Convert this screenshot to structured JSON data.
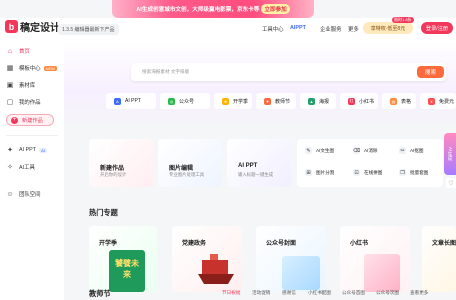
{
  "banner": {
    "text": "AI生成创意城市文创，大师级赢电影票，京东卡等",
    "cta": "立即参加"
  },
  "header": {
    "logo": "稿定设计",
    "slogan": "1.3.5 编辑器最新下产品",
    "nav": [
      "工具中心",
      "AIPPT",
      "企业服务",
      "更多"
    ],
    "vip": "享特权·低至8元",
    "vip_tag": "限时1.8折",
    "register": "登录/注册"
  },
  "sidebar": {
    "items": [
      {
        "label": "首页",
        "icon": "home-icon"
      },
      {
        "label": "模板中心",
        "icon": "template-icon",
        "tag": "NEW"
      },
      {
        "label": "素材库",
        "icon": "material-icon"
      },
      {
        "label": "我的作品",
        "icon": "folder-icon"
      }
    ],
    "new_work": "新建作品",
    "ai": [
      {
        "label": "AI PPT",
        "tag": "AI"
      },
      {
        "label": "AI工具"
      }
    ],
    "team": "团队空间"
  },
  "search": {
    "placeholder": "搜索海报素材 文字排版",
    "button": "搜索"
  },
  "quick": [
    "AI PPT",
    "公众号",
    "开学季",
    "教师节",
    "海报",
    "小红书",
    "表格",
    "免费元"
  ],
  "cards": [
    {
      "title": "新建作品",
      "sub": "开启你的设计"
    },
    {
      "title": "图片编辑",
      "sub": "专业图片处理工具"
    },
    {
      "title": "AI PPT",
      "sub": "输入标题一键生成"
    }
  ],
  "tools": [
    "AI文生图",
    "AI消除",
    "AI抠图",
    "图片分割",
    "在线拼图",
    "批量套图"
  ],
  "hot_title": "热门专题",
  "hot": [
    {
      "label": "开学季",
      "badge": "饕餮未来"
    },
    {
      "label": "党建政务"
    },
    {
      "label": "公众号封面"
    },
    {
      "label": "小红书"
    },
    {
      "label": "文章长图"
    }
  ],
  "teacher_title": "教师节",
  "tabs": [
    "节日祝福",
    "活动促销",
    "感谢信",
    "小红书配图",
    "公众号首图",
    "公众号次图",
    "查看更多"
  ],
  "float": "AI生成"
}
